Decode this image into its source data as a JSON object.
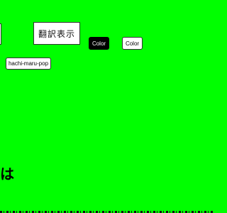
{
  "background_color": "#00ff00",
  "translate_button": {
    "label": "翻訳表示"
  },
  "color_buttons": [
    {
      "label": "Color",
      "style": "dark"
    },
    {
      "label": "Color",
      "style": "light"
    }
  ],
  "font_button": {
    "label": "hachi-maru-pop"
  },
  "greeting": {
    "visible_text": "ちは"
  }
}
